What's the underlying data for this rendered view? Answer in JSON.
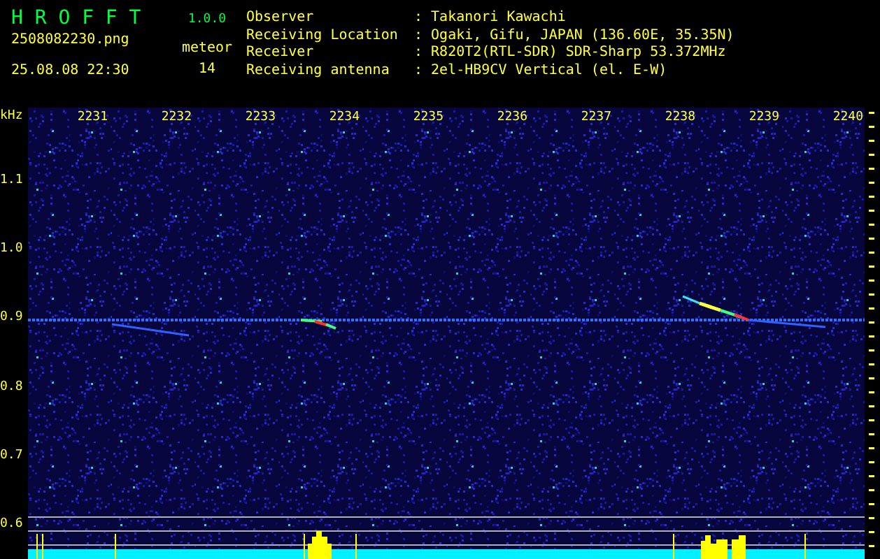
{
  "header": {
    "app_name": "H R O F F T",
    "version": "1.0.0",
    "filename": "2508082230.png",
    "datetime": "25.08.08 22:30",
    "count_label": "meteor",
    "count": "14"
  },
  "info": [
    {
      "label": "Observer",
      "value": ": Takanori Kawachi"
    },
    {
      "label": "Receiving Location",
      "value": ": Ogaki, Gifu, JAPAN (136.60E, 35.35N)"
    },
    {
      "label": "Receiver",
      "value": ": R820T2(RTL-SDR) SDR-Sharp 53.372MHz"
    },
    {
      "label": "Receiving antenna",
      "value": ": 2el-HB9CV Vertical (el. E-W)"
    }
  ],
  "spectrogram": {
    "y_unit": "kHz",
    "x_labels": [
      "2231",
      "2232",
      "2233",
      "2234",
      "2235",
      "2236",
      "2237",
      "2238",
      "2239",
      "2240"
    ],
    "y_labels": [
      "1.1",
      "1.0",
      "0.9",
      "0.8",
      "0.7",
      "0.6"
    ]
  }
}
